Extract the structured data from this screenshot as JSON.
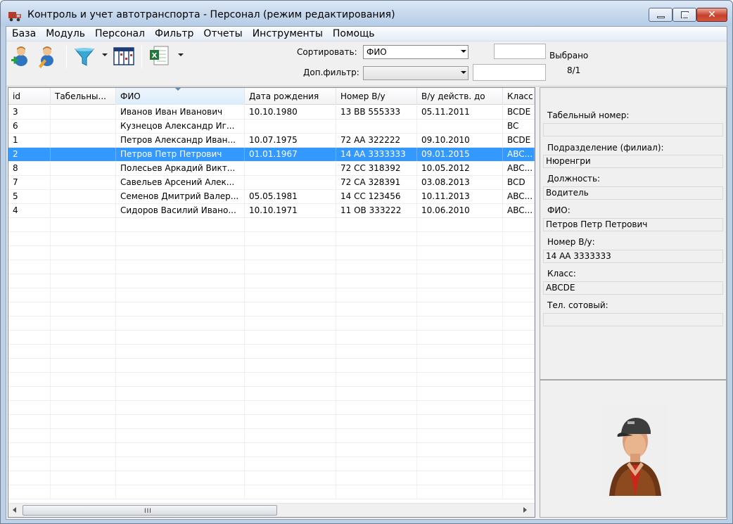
{
  "window": {
    "title": "Контроль и учет автотранспорта - Персонал  (режим редактирования)"
  },
  "menu": [
    "База",
    "Модуль",
    "Персонал",
    "Фильтр",
    "Отчеты",
    "Инструменты",
    "Помощь"
  ],
  "toolbar": {
    "icons": [
      "add-user-icon",
      "edit-user-icon",
      "filter-icon",
      "columns-icon",
      "excel-export-icon"
    ],
    "sort_label": "Сортировать:",
    "sort_value": "ФИО",
    "filter_label": "Доп.фильтр:",
    "filter_value": "",
    "selected_label": "Выбрано",
    "selected_count": "8/1"
  },
  "grid": {
    "columns": [
      "id",
      "Табельны...",
      "ФИО",
      "Дата рождения",
      "Номер В/у",
      "В/у действ. до",
      "Класс"
    ],
    "sorted_column": 2,
    "selected_row": 3,
    "rows": [
      [
        "3",
        "",
        "Иванов Иван Иванович",
        "10.10.1980",
        "13 ВВ 555333",
        "05.11.2011",
        "BCDE"
      ],
      [
        "6",
        "",
        "Кузнецов Александр Иг...",
        "",
        "",
        "",
        "BC"
      ],
      [
        "1",
        "",
        "Петров Александр Иван...",
        "10.07.1975",
        "72 АА 322222",
        "09.10.2010",
        "BCDE"
      ],
      [
        "2",
        "",
        "Петров Петр Петрович",
        "01.01.1967",
        "14 АА 3333333",
        "09.01.2015",
        "ABC..."
      ],
      [
        "8",
        "",
        "Полесьев Аркадий Викт...",
        "",
        "72 СС 318392",
        "10.05.2012",
        "ABC..."
      ],
      [
        "7",
        "",
        "Савельев Арсений Алек...",
        "",
        "72 СА 328391",
        "03.08.2013",
        "BCD"
      ],
      [
        "5",
        "",
        "Семенов Дмитрий Валер...",
        "05.05.1981",
        "14 СС 123456",
        "10.11.2013",
        "ABC..."
      ],
      [
        "4",
        "",
        "Сидоров Василий Ивано...",
        "10.10.1971",
        "11 ОВ 333222",
        "10.06.2010",
        "ABC..."
      ]
    ],
    "scrollbar_grip": "III"
  },
  "details": {
    "fields": [
      {
        "label": "Табельный номер:",
        "value": ""
      },
      {
        "label": "Подразделение (филиал):",
        "value": "Нюренгри"
      },
      {
        "label": "Должность:",
        "value": "Водитель"
      },
      {
        "label": "ФИО:",
        "value": "Петров Петр Петрович"
      },
      {
        "label": "Номер В/у:",
        "value": "14 АА 3333333"
      },
      {
        "label": "Класс:",
        "value": "ABCDE"
      },
      {
        "label": "Тел. сотовый:",
        "value": ""
      }
    ]
  },
  "photo": {
    "icon": "driver-avatar-icon"
  }
}
